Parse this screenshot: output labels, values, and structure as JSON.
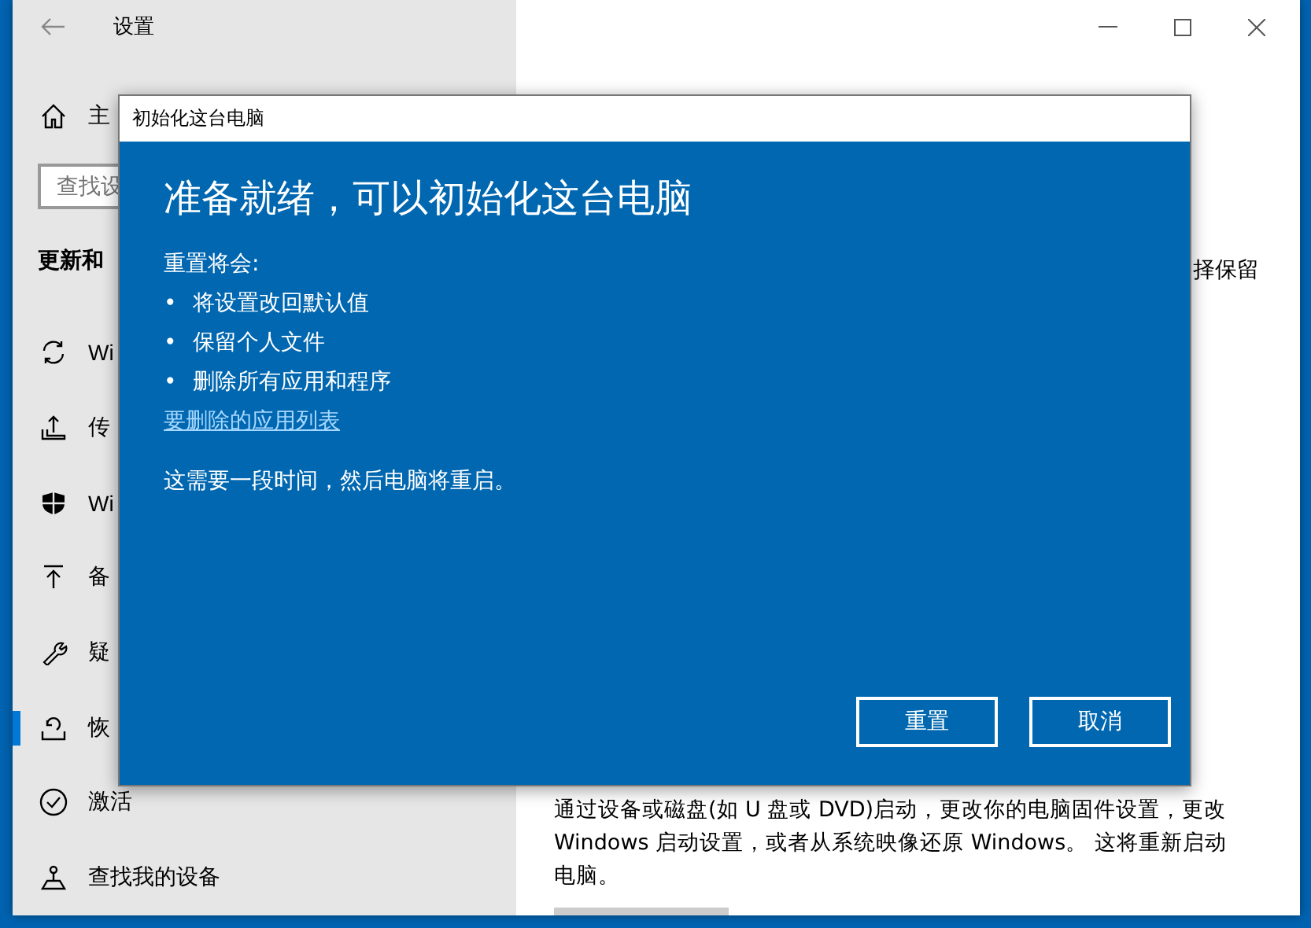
{
  "window": {
    "title": "设置"
  },
  "sidebar": {
    "home": "主",
    "search": {
      "placeholder": "查找设"
    },
    "section": "更新和",
    "items": [
      {
        "label": "Wi",
        "selected": false
      },
      {
        "label": "传",
        "selected": false
      },
      {
        "label": "Wi",
        "selected": false
      },
      {
        "label": "备",
        "selected": false
      },
      {
        "label": "疑",
        "selected": false
      },
      {
        "label": "恢",
        "selected": true
      },
      {
        "label": "激活",
        "selected": false
      },
      {
        "label": "查找我的设备",
        "selected": false
      }
    ]
  },
  "content": {
    "fragment": "择保留",
    "paragraph": "通过设备或磁盘(如 U 盘或 DVD)启动，更改你的电脑固件设置，更改 Windows 启动设置，或者从系统映像还原 Windows。 这将重新启动电脑。"
  },
  "dialog": {
    "title": "初始化这台电脑",
    "heading": "准备就绪，可以初始化这台电脑",
    "intro": "重置将会:",
    "bullets": [
      {
        "mark": "•",
        "text": "将设置改回默认值"
      },
      {
        "mark": "•",
        "text": "保留个人文件"
      },
      {
        "mark": "•",
        "text": "删除所有应用和程序"
      }
    ],
    "link": "要删除的应用列表",
    "note": "这需要一段时间，然后电脑将重启。",
    "buttons": [
      "重置",
      "取消"
    ]
  }
}
